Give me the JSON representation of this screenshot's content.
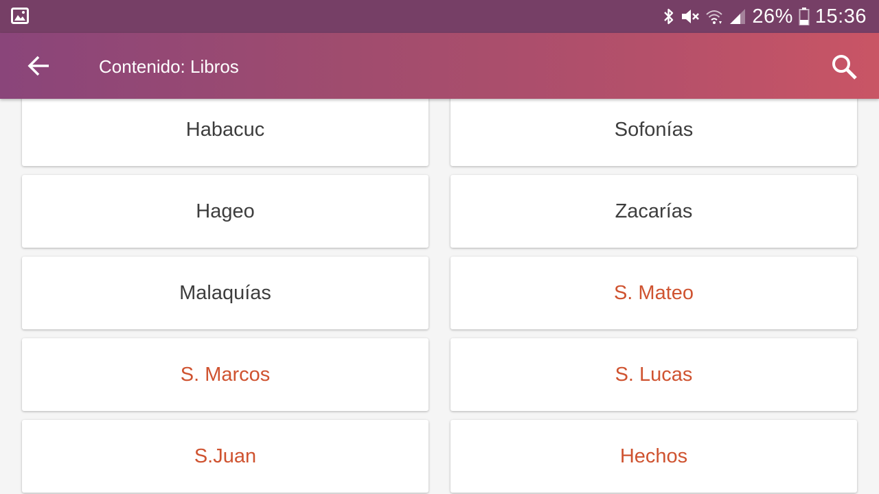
{
  "status_bar": {
    "battery": "26%",
    "time": "15:36"
  },
  "app_bar": {
    "title": "Contenido: Libros"
  },
  "books": [
    {
      "label": "Habacuc",
      "new_testament": false
    },
    {
      "label": "Sofonías",
      "new_testament": false
    },
    {
      "label": "Hageo",
      "new_testament": false
    },
    {
      "label": "Zacarías",
      "new_testament": false
    },
    {
      "label": "Malaquías",
      "new_testament": false
    },
    {
      "label": "S. Mateo",
      "new_testament": true
    },
    {
      "label": "S. Marcos",
      "new_testament": true
    },
    {
      "label": "S. Lucas",
      "new_testament": true
    },
    {
      "label": "S.Juan",
      "new_testament": true
    },
    {
      "label": "Hechos",
      "new_testament": true
    }
  ],
  "colors": {
    "status_bar": "#763f66",
    "app_bar_start": "#8a457a",
    "app_bar_end": "#c95565",
    "old_testament_text": "#3d3d3d",
    "new_testament_text": "#cf5330"
  },
  "icons": {
    "status_left": "gallery-icon",
    "status_right": [
      "bluetooth-icon",
      "mute-icon",
      "wifi-icon",
      "signal-icon",
      "battery-icon"
    ],
    "back": "arrow-back-icon",
    "search": "search-icon"
  }
}
